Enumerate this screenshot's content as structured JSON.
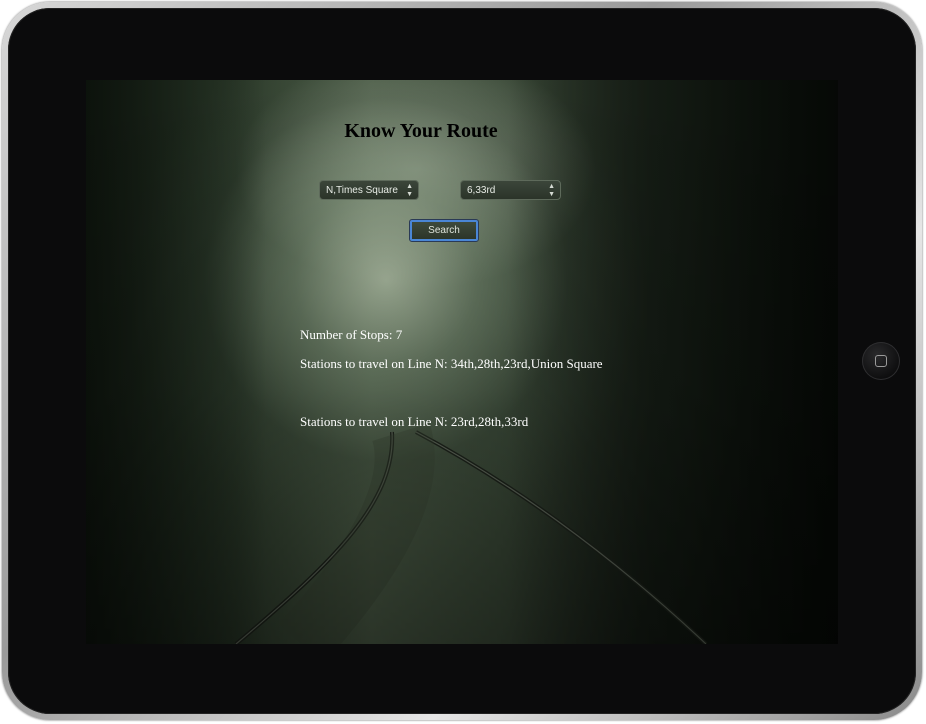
{
  "app": {
    "title": "Know Your Route"
  },
  "form": {
    "origin_select": {
      "selected": "N,Times Square"
    },
    "destination_select": {
      "selected": "6,33rd"
    },
    "search_label": "Search"
  },
  "results": {
    "stops_text": "Number of Stops: 7",
    "segments": [
      {
        "text": "Stations to travel on Line N: 34th,28th,23rd,Union Square"
      },
      {
        "text": "Stations to travel on Line N: 23rd,28th,33rd"
      }
    ]
  },
  "colors": {
    "title_text": "#000000",
    "result_text": "#ffffff",
    "button_focus_ring": "#4a86d6",
    "device_bezel": "#0b0b0c"
  },
  "icons": {
    "select_arrow": "updown-chevron-icon",
    "home_button": "home-button-icon"
  }
}
